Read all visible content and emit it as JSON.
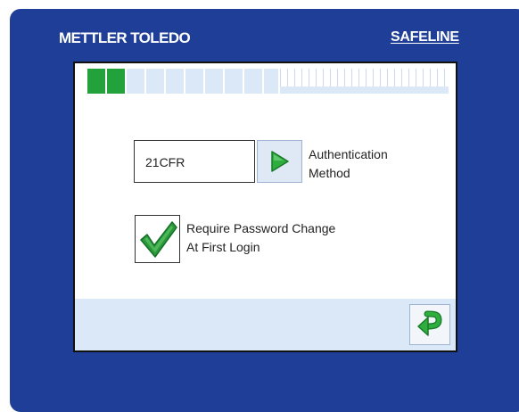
{
  "brand": {
    "left": "METTLER TOLEDO",
    "right": "SAFELINE"
  },
  "progress": {
    "active_segments": 2,
    "total_segments": 10
  },
  "authentication": {
    "value": "21CFR",
    "label_line1": "Authentication",
    "label_line2": "Method"
  },
  "password_change": {
    "checked": true,
    "label_line1": "Require Password Change",
    "label_line2": "At First Login"
  },
  "icons": {
    "next": "play-arrow-icon",
    "check": "checkmark-icon",
    "back": "return-arrow-icon"
  },
  "colors": {
    "frame": "#1f3e97",
    "accent_green": "#23a23b",
    "panel_light": "#dbe8f7"
  }
}
